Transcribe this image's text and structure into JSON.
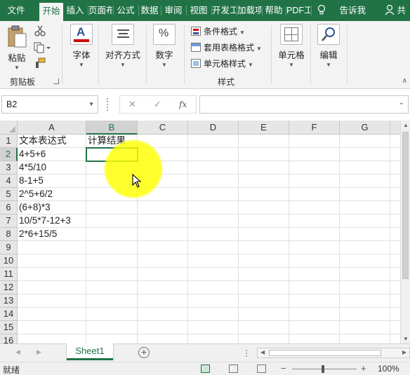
{
  "ribbon_tabs": [
    {
      "label": "文件",
      "active": false
    },
    {
      "label": "开始",
      "active": true
    },
    {
      "label": "插入",
      "active": false
    },
    {
      "label": "页面布",
      "active": false
    },
    {
      "label": "公式",
      "active": false
    },
    {
      "label": "数据",
      "active": false
    },
    {
      "label": "审阅",
      "active": false
    },
    {
      "label": "视图",
      "active": false
    },
    {
      "label": "开发工",
      "active": false
    },
    {
      "label": "加载项",
      "active": false
    },
    {
      "label": "帮助",
      "active": false
    },
    {
      "label": "PDF工",
      "active": false
    }
  ],
  "tell_me": {
    "label": "告诉我",
    "icon": "lightbulb-icon"
  },
  "share": {
    "label": "共",
    "icon": "person-icon"
  },
  "ribbon": {
    "clipboard": {
      "paste_label": "粘贴",
      "group_label": "剪贴板"
    },
    "font": {
      "label": "字体"
    },
    "alignment": {
      "label": "对齐方式"
    },
    "number": {
      "label": "数字"
    },
    "styles": {
      "conditional_format": "条件格式",
      "table_format": "套用表格格式",
      "cell_styles": "单元格样式",
      "group_label": "样式"
    },
    "cells": {
      "label": "单元格"
    },
    "editing": {
      "label": "编辑"
    }
  },
  "formula_bar": {
    "name_box": "B2",
    "fx_label": "fx",
    "formula": ""
  },
  "grid": {
    "columns": [
      "A",
      "B",
      "C",
      "D",
      "E",
      "F",
      "G"
    ],
    "selected_column": "B",
    "rows": [
      "1",
      "2",
      "3",
      "4",
      "5",
      "6",
      "7",
      "8",
      "9",
      "10",
      "11",
      "12",
      "13",
      "14",
      "15",
      "16"
    ],
    "selected_row": "2",
    "cells_a": [
      "文本表达式",
      "4+5+6",
      "4*5/10",
      "8-1+5",
      "2^5+6/2",
      "(6+8)*3",
      "10/5*7-12+3",
      "2*6+15/5"
    ],
    "cells_b": [
      "计算结果"
    ]
  },
  "sheets": [
    "Sheet1"
  ],
  "status": {
    "ready": "就绪",
    "zoom": "100%"
  },
  "colors": {
    "accent": "#217346",
    "highlight": "#ffff00"
  }
}
